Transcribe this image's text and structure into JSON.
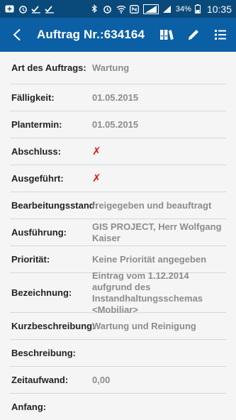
{
  "status": {
    "battery": "34%",
    "time": "10:35"
  },
  "header": {
    "title": "Auftrag Nr.:634164"
  },
  "rows": [
    {
      "label": "Art des Auftrags:",
      "value": "Wartung"
    },
    {
      "label": "Fälligkeit:",
      "value": "01.05.2015"
    },
    {
      "label": "Plantermin:",
      "value": "01.05.2015"
    },
    {
      "label": "Abschluss:",
      "value": "✗"
    },
    {
      "label": "Ausgeführt:",
      "value": "✗"
    },
    {
      "label": "Bearbeitungsstand:",
      "value": "freigegeben und beauftragt"
    },
    {
      "label": "Ausführung:",
      "value": "GIS PROJECT, Herr Wolfgang Kaiser"
    },
    {
      "label": "Priorität:",
      "value": "Keine Priorität angegeben"
    },
    {
      "label": "Bezeichnung:",
      "value": "Eintrag vom 1.12.2014 aufgrund des Instandhaltungsschemas <Mobiliar>"
    },
    {
      "label": "Kurzbeschreibung:",
      "value": "Wartung und Reinigung"
    },
    {
      "label": "Beschreibung:",
      "value": ""
    },
    {
      "label": "Zeitaufwand:",
      "value": "0,00"
    },
    {
      "label": "Anfang:",
      "value": ""
    }
  ]
}
